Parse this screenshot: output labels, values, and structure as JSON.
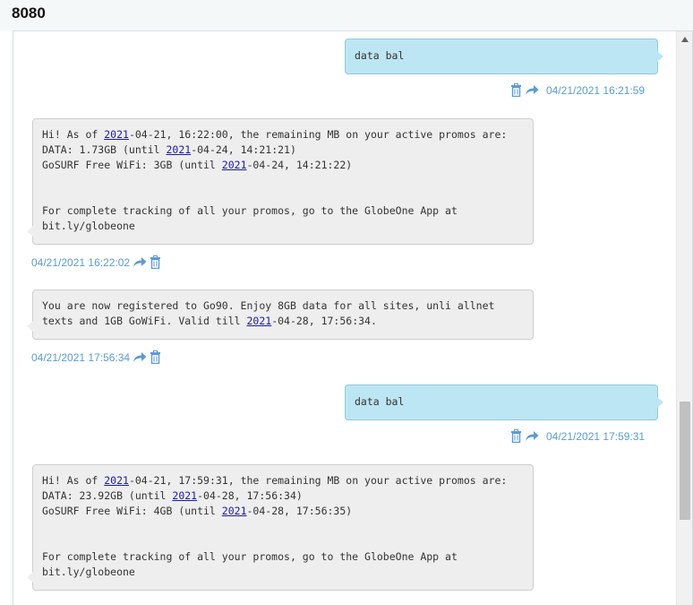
{
  "header": {
    "title": "8080"
  },
  "messages": [
    {
      "dir": "sent",
      "text": "data bal",
      "time": "04/21/2021 16:21:59"
    },
    {
      "dir": "recv",
      "time": "04/21/2021 16:22:02",
      "lines": [
        [
          "Hi! As of ",
          "2021",
          "-04-21, 16:22:00, the remaining MB on your active promos are:"
        ],
        [
          "DATA: 1.73GB (until ",
          "2021",
          "-04-24, 14:21:21)"
        ],
        [
          "GoSURF Free WiFi: 3GB (until ",
          "2021",
          "-04-24, 14:21:22)"
        ],
        [
          ""
        ],
        [
          ""
        ],
        [
          "For complete tracking of all your promos, go to the GlobeOne App at"
        ],
        [
          "bit.ly/globeone"
        ]
      ]
    },
    {
      "dir": "recv",
      "time": "04/21/2021 17:56:34",
      "lines": [
        [
          "You are now registered to Go90. Enjoy 8GB data for all sites, unli allnet"
        ],
        [
          "texts and 1GB GoWiFi. Valid till ",
          "2021",
          "-04-28, 17:56:34."
        ]
      ]
    },
    {
      "dir": "sent",
      "text": "data bal",
      "time": "04/21/2021 17:59:31"
    },
    {
      "dir": "recv",
      "time": "",
      "lines": [
        [
          "Hi! As of ",
          "2021",
          "-04-21, 17:59:31, the remaining MB on your active promos are:"
        ],
        [
          "DATA: 23.92GB (until ",
          "2021",
          "-04-28, 17:56:34)"
        ],
        [
          "GoSURF Free WiFi: 4GB (until ",
          "2021",
          "-04-28, 17:56:35)"
        ],
        [
          ""
        ],
        [
          ""
        ],
        [
          "For complete tracking of all your promos, go to the GlobeOne App at"
        ],
        [
          "bit.ly/globeone"
        ]
      ]
    }
  ],
  "colors": {
    "sent_bubble": "#bde6f4",
    "recv_bubble": "#eeeeee",
    "timestamp": "#5b9bd2",
    "year_link": "#1a1aa6"
  },
  "icons": [
    "trash-icon",
    "forward-icon"
  ]
}
